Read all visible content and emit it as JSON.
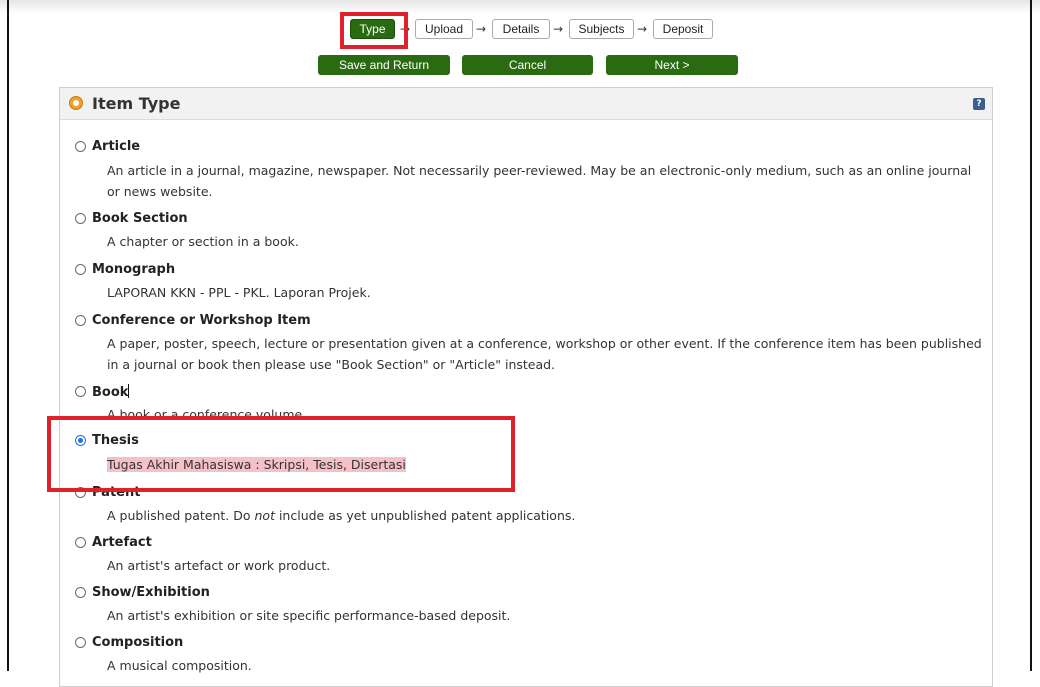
{
  "workflow": {
    "steps": [
      "Type",
      "Upload",
      "Details",
      "Subjects",
      "Deposit"
    ],
    "active_step": "Type",
    "arrow_glyph": "→"
  },
  "actions": {
    "save_return": "Save and Return",
    "cancel": "Cancel",
    "next": "Next >"
  },
  "panel": {
    "title": "Item Type",
    "help_glyph": "?"
  },
  "item_types": [
    {
      "label": "Article",
      "description": "An article in a journal, magazine, newspaper. Not necessarily peer-reviewed. May be an electronic-only medium, such as an online journal or news website.",
      "selected": false
    },
    {
      "label": "Book Section",
      "description": "A chapter or section in a book.",
      "selected": false
    },
    {
      "label": "Monograph",
      "description": "LAPORAN KKN - PPL - PKL. Laporan Projek.",
      "selected": false
    },
    {
      "label": "Conference or Workshop Item",
      "description": "A paper, poster, speech, lecture or presentation given at a conference, workshop or other event. If the conference item has been published in a journal or book then please use \"Book Section\" or \"Article\" instead.",
      "selected": false
    },
    {
      "label": "Book",
      "description": "A book or a conference volume.",
      "selected": false
    },
    {
      "label": "Thesis",
      "description": "Tugas Akhir Mahasiswa : Skripsi, Tesis, Disertasi",
      "selected": true
    },
    {
      "label": "Patent",
      "description_pre": "A published patent. Do ",
      "description_em": "not",
      "description_post": " include as yet unpublished patent applications.",
      "selected": false
    },
    {
      "label": "Artefact",
      "description": "An artist's artefact or work product.",
      "selected": false
    },
    {
      "label": "Show/Exhibition",
      "description": "An artist's exhibition or site specific performance-based deposit.",
      "selected": false
    },
    {
      "label": "Composition",
      "description": "A musical composition.",
      "selected": false
    }
  ],
  "colors": {
    "button_green": "#2a6b12",
    "highlight_red": "#e0202a",
    "selected_desc_bg": "#f6c1c6"
  }
}
